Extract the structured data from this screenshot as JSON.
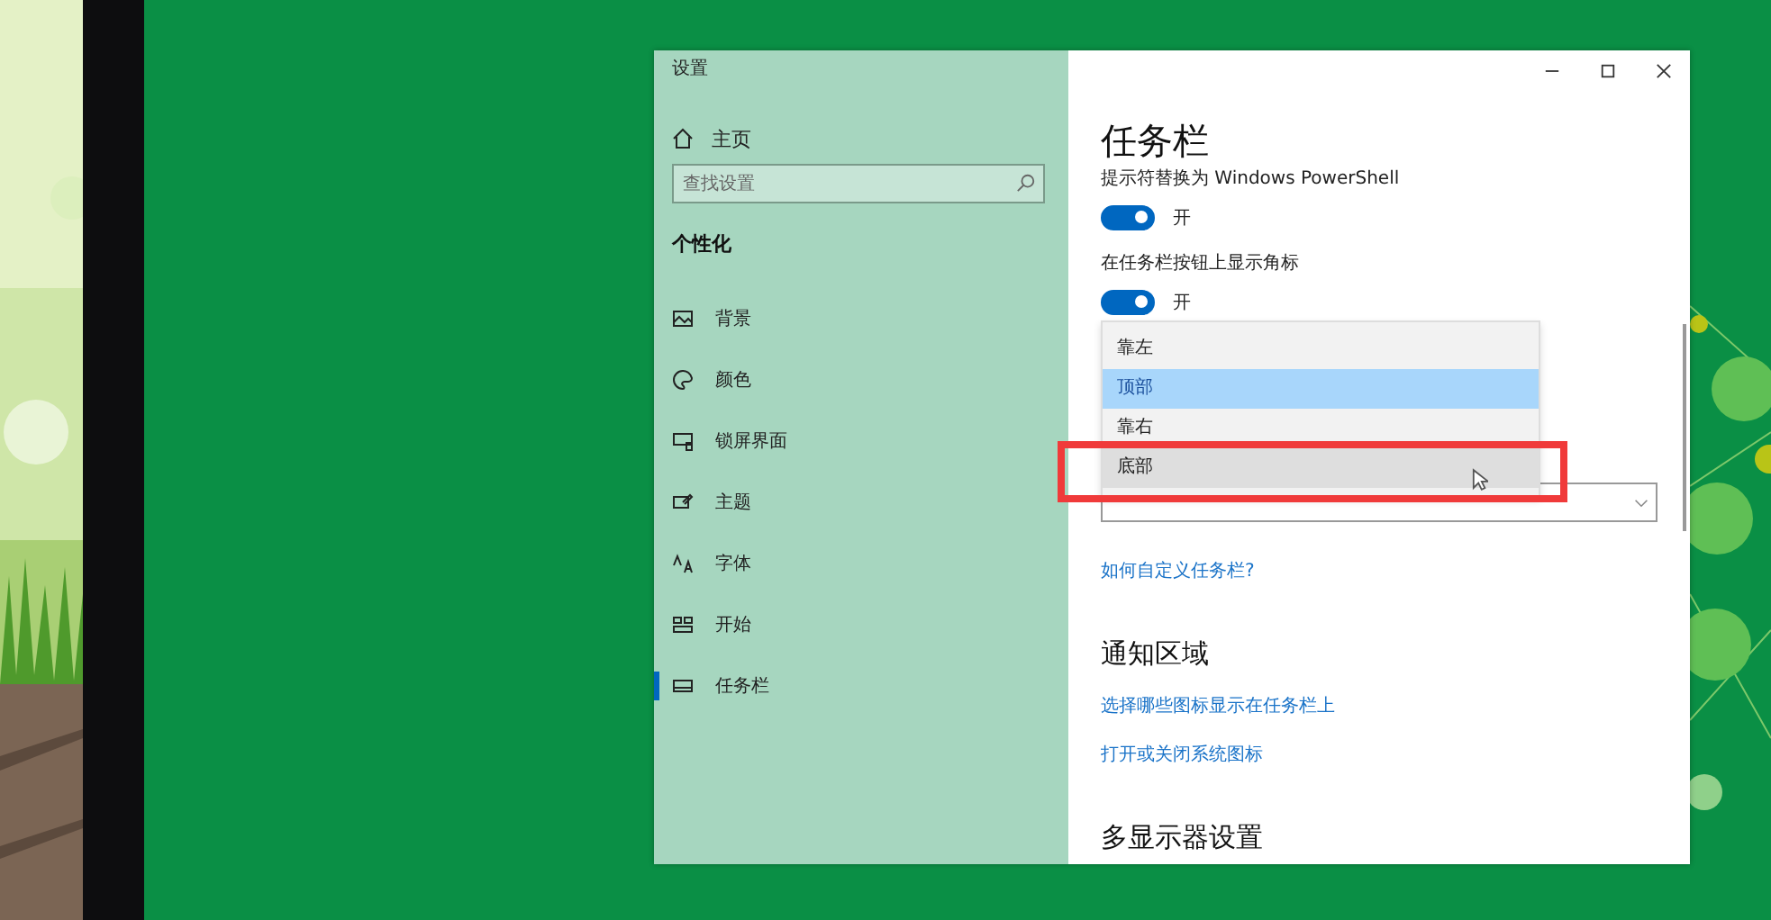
{
  "window": {
    "title": "设置"
  },
  "sidebar": {
    "home": "主页",
    "search": {
      "placeholder": "查找设置"
    },
    "section": "个性化",
    "items": [
      {
        "label": "背景",
        "selected": false
      },
      {
        "label": "颜色",
        "selected": false
      },
      {
        "label": "锁屏界面",
        "selected": false
      },
      {
        "label": "主题",
        "selected": false
      },
      {
        "label": "字体",
        "selected": false
      },
      {
        "label": "开始",
        "selected": false
      },
      {
        "label": "任务栏",
        "selected": true
      }
    ]
  },
  "content": {
    "title": "任务栏",
    "toggles": [
      {
        "label": "提示符替换为 Windows PowerShell",
        "on": true,
        "state_text": "开"
      },
      {
        "label": "在任务栏按钮上显示角标",
        "on": true,
        "state_text": "开"
      }
    ],
    "dropdown": {
      "options": [
        {
          "label": "靠左",
          "selected": false,
          "hovered": false
        },
        {
          "label": "顶部",
          "selected": true,
          "hovered": false
        },
        {
          "label": "靠右",
          "selected": false,
          "hovered": false
        },
        {
          "label": "底部",
          "selected": false,
          "hovered": true
        }
      ]
    },
    "help_link": "如何自定义任务栏?",
    "notification_heading": "通知区域",
    "notification_links": [
      "选择哪些图标显示在任务栏上",
      "打开或关闭系统图标"
    ],
    "multi_display_heading": "多显示器设置"
  }
}
